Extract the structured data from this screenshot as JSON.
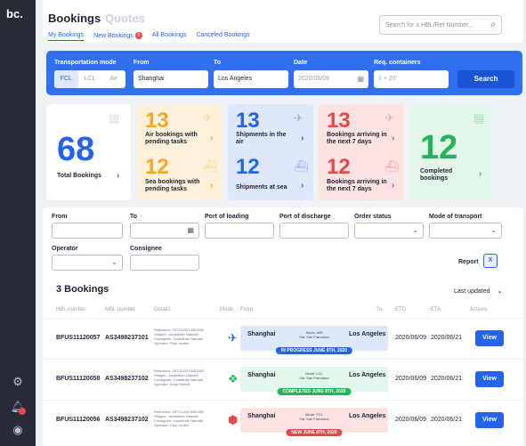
{
  "app": {
    "logo": "bc."
  },
  "header": {
    "title": "Bookings",
    "title_secondary": "Quotes",
    "tabs": [
      {
        "label": "My Bookings"
      },
      {
        "label": "New Bookings",
        "count": "6"
      },
      {
        "label": "All Bookings"
      },
      {
        "label": "Canceled Bookings"
      }
    ],
    "search_placeholder": "Search for a HBL/Ref Number..."
  },
  "searchbar": {
    "transport_label": "Transportation mode",
    "modes": [
      "FCL",
      "LCL",
      "Air"
    ],
    "active_mode": "FCL",
    "from_label": "From",
    "from_value": "Shanghai",
    "to_label": "To",
    "to_value": "Los Angeles",
    "date_label": "Date",
    "date_placeholder": "2020/06/09",
    "containers_label": "Req. containers",
    "containers_placeholder": "1 × 20'",
    "search_button": "Search"
  },
  "stats": {
    "total": {
      "value": "68",
      "label": "Total Bookings"
    },
    "air_pending": {
      "value": "13",
      "label": "Air bookings with pending tasks"
    },
    "sea_pending": {
      "value": "12",
      "label": "Sea bookings with pending tasks"
    },
    "air_shipments": {
      "value": "13",
      "label": "Shipments in the air"
    },
    "sea_shipments": {
      "value": "12",
      "label": "Shipments at sea"
    },
    "air_arriving": {
      "value": "13",
      "label": "Bookings arriving in the next 7 days"
    },
    "sea_arriving": {
      "value": "12",
      "label": "Bookings arriving in the next 7 days"
    },
    "completed": {
      "value": "12",
      "label": "Completed bookings"
    }
  },
  "filters": {
    "from": "From",
    "to": "To",
    "port_loading": "Port of loading",
    "port_discharge": "Port of discharge",
    "order_status": "Order status",
    "mode_transport": "Mode of transport",
    "operator": "Operator",
    "consignee": "Consignee",
    "report": "Report",
    "report_icon": "X"
  },
  "list": {
    "count": "3 Bookings",
    "sort": "Last updated",
    "headers": [
      "HBL number",
      "MBL number",
      "Details",
      "Mode",
      "From",
      "To",
      "ETD",
      "ETA",
      "Actions"
    ],
    "rows": [
      {
        "hbl": "BFUS11120057",
        "mbl": "AS3498237101",
        "ref": "Reference: 2572142574453452",
        "shipper": "Shipper: Johanthan Namath",
        "consignee": "Consignee: Johanthan Namath",
        "operator": "Operator: Paul Jorden",
        "from": "Shanghai",
        "to": "Los Angeles",
        "mode": "Mode: AIR",
        "via": "Via: San Francisco",
        "status": "IN PROGRESS JUNE 8TH, 2020",
        "etd": "2020/06/09",
        "eta": "2020/06/21",
        "action": "View"
      },
      {
        "hbl": "BFUS11120058",
        "mbl": "AS3498237102",
        "ref": "Reference: 2572142574453452",
        "shipper": "Shipper: Johanthan Namath",
        "consignee": "Consignee: Johanthan Namath",
        "operator": "Operator: Andy Robert",
        "from": "Shanghai",
        "to": "Los Angeles",
        "mode": "Mode: LCL",
        "via": "Via: San Francisco",
        "status": "COMPLETED JUNE 8TH, 2020",
        "etd": "2020/06/09",
        "eta": "2020/06/21",
        "action": "View"
      },
      {
        "hbl": "BFUS11120056",
        "mbl": "AS3498237102",
        "ref": "Reference: 2572142574453452",
        "shipper": "Shipper: Johanthan Namath",
        "consignee": "Consignee: Johanthan Namath",
        "operator": "Operator: Paul Jorden",
        "from": "Shanghai",
        "to": "Los Angeles",
        "mode": "Mode: FCL",
        "via": "Via: San Francisco",
        "status": "NEW JUNE 8TH, 2020",
        "etd": "2020/06/09",
        "eta": "2020/06/21",
        "action": "View"
      }
    ]
  },
  "colors": {
    "accent": "#2563eb",
    "orange": "#f5a623",
    "red": "#e5484d",
    "green": "#27b35a"
  }
}
